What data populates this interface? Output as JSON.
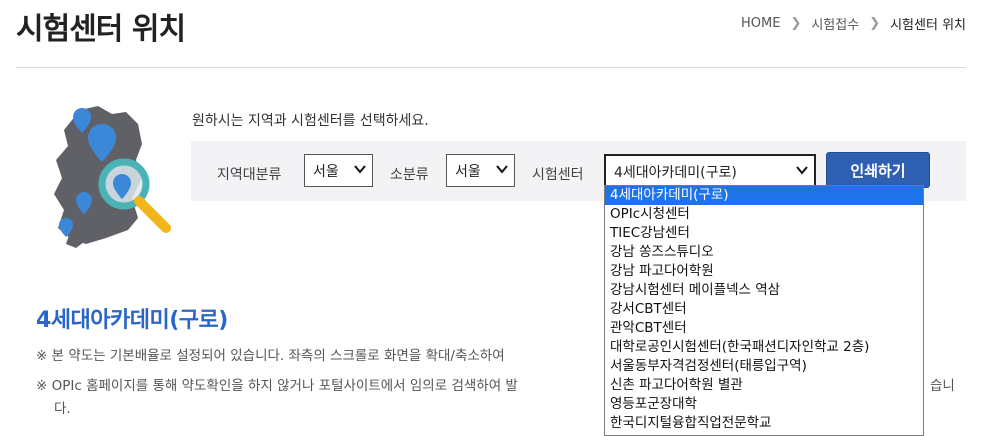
{
  "header": {
    "title": "시험센터 위치",
    "breadcrumb": [
      "HOME",
      "시험접수",
      "시험센터 위치"
    ]
  },
  "instruction": "원하시는 지역과 시험센터를 선택하세요.",
  "filters": {
    "region_label": "지역대분류",
    "region_value": "서울",
    "subregion_label": "소분류",
    "subregion_value": "서울",
    "center_label": "시험센터",
    "center_value": "4세대아카데미(구로)",
    "print_button": "인쇄하기"
  },
  "dropdown": {
    "options": [
      "4세대아카데미(구로)",
      "OPIc시청센터",
      "TIEC강남센터",
      "강남 쏭즈스튜디오",
      "강남 파고다어학원",
      "강남시험센터 메이플넥스 역삼",
      "강서CBT센터",
      "관악CBT센터",
      "대학로공인시험센터(한국패션디자인학교 2층)",
      "서울동부자격검정센터(태릉입구역)",
      "신촌 파고다어학원 별관",
      "영등포군장대학",
      "한국디지털융합직업전문학교"
    ],
    "selected_index": 0
  },
  "center": {
    "name": "4세대아카데미(구로)",
    "notes": [
      "※ 본 약도는 기본배율로 설정되어 있습니다. 좌측의 스크롤로 화면을 확대/축소하여",
      "※ OPIc 홈페이지를 통해 약도확인을 하지 않거나 포털사이트에서 임의로 검색하여 발",
      "습니",
      "다."
    ]
  },
  "colors": {
    "accent": "#2a66c8",
    "button": "#2e5fb0",
    "selected_option": "#1e73e8",
    "map_pin": "#3c88d8",
    "magnifier_ring": "#4ab3b8",
    "magnifier_handle": "#f2b51c"
  },
  "icons": {
    "breadcrumb_separator": "chevron-right-icon",
    "select_arrow": "chevron-down-icon",
    "map": "korea-map-magnifier-icon"
  }
}
